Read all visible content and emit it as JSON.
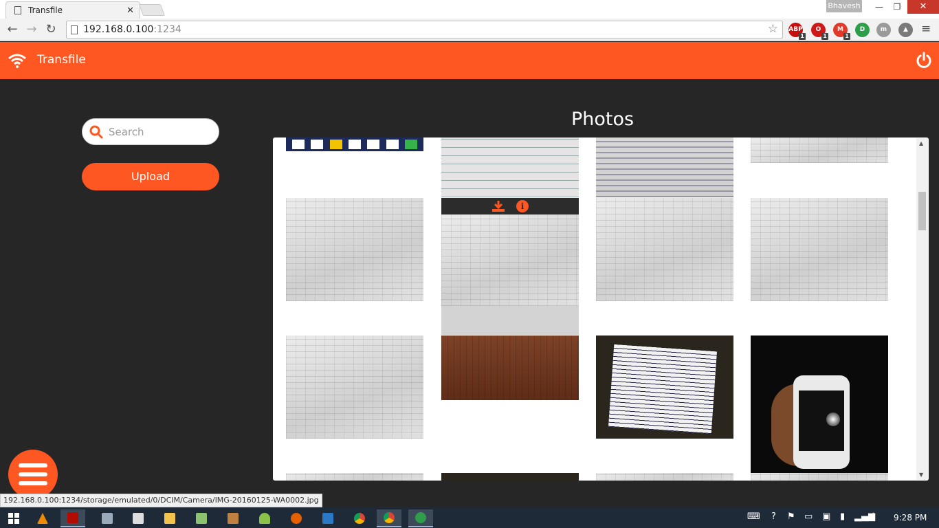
{
  "browser": {
    "tab_title": "Transfile",
    "tab_close": "✕",
    "profile_name": "Bhavesh",
    "window_min": "—",
    "window_restore": "❐",
    "window_close": "✕",
    "url_host": "192.168.0.100",
    "url_port": ":1234",
    "extensions": [
      {
        "label": "ABP",
        "badge": "1",
        "color": "#c70d0d",
        "icon": "adblock-plus-icon"
      },
      {
        "label": "O",
        "badge": "1",
        "color": "#d01818",
        "icon": "opera-icon"
      },
      {
        "label": "M",
        "badge": "1",
        "color": "#e23a2a",
        "icon": "gmail-icon"
      },
      {
        "label": "D",
        "color": "#2e9e4a",
        "icon": "pushbullet-icon"
      },
      {
        "label": "m",
        "color": "#9a9a9a",
        "icon": "extension-m-icon"
      },
      {
        "label": "▲",
        "color": "#7a7a7a",
        "icon": "google-drive-icon"
      }
    ]
  },
  "app": {
    "title": "Transfile",
    "accent": "#fe5722",
    "search_placeholder": "Search",
    "upload_label": "Upload",
    "section_title": "Photos",
    "hover_info": "i"
  },
  "photos": [
    {
      "kind": "banner",
      "name": "photo-banner-logos"
    },
    {
      "kind": "ruled",
      "name": "photo-ruled-notebook"
    },
    {
      "kind": "handwritten",
      "name": "photo-handwritten-page"
    },
    {
      "kind": "paper",
      "name": "photo-paper-top-right"
    },
    {
      "kind": "paper",
      "name": "photo-table-sheet-1"
    },
    {
      "kind": "paper",
      "name": "photo-table-sheet-hover"
    },
    {
      "kind": "paper",
      "name": "photo-table-sheet-2"
    },
    {
      "kind": "paper",
      "name": "photo-table-sheet-3"
    },
    {
      "kind": "paper",
      "name": "photo-table-sheet-4"
    },
    {
      "kind": "wood",
      "name": "photo-wood-texture"
    },
    {
      "kind": "note",
      "name": "photo-written-notes"
    },
    {
      "kind": "dark",
      "name": "photo-phone-in-hand"
    }
  ],
  "status_link": "192.168.0.100:1234/storage/emulated/0/DCIM/Camera/IMG-20160125-WA0002.jpg",
  "taskbar": {
    "clock": "9:28 PM"
  }
}
